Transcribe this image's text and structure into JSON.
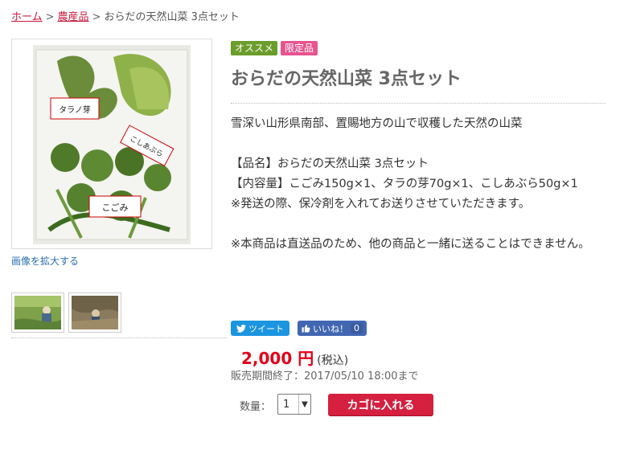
{
  "breadcrumb": {
    "home": "ホーム",
    "separator": ">",
    "category": "農産品",
    "current": "おらだの天然山菜 3点セット"
  },
  "gallery": {
    "zoom_link": "画像を拡大する",
    "main_photo_labels": {
      "label1": "タラノ芽",
      "label2": "こしあぶら",
      "label3": "こごみ"
    }
  },
  "badges": {
    "recommend": "オススメ",
    "limited": "限定品"
  },
  "product": {
    "title": "おらだの天然山菜 3点セット",
    "description": [
      "雪深い山形県南部、置賜地方の山で収穫した天然の山菜",
      "",
      "【品名】おらだの天然山菜 3点セット",
      "【内容量】こごみ150g×1、タラの芽70g×1、こしあぶら50g×1",
      "※発送の際、保冷剤を入れてお送りさせていただきます。",
      "",
      "※本商品は直送品のため、他の商品と一緒に送ることはできません。"
    ]
  },
  "share": {
    "tweet": "ツイート",
    "like": "いいね！",
    "like_count": "0"
  },
  "price": {
    "amount": "2,000 円",
    "tax": "(税込)",
    "sale_end": "販売期間終了：2017/05/10 18:00まで"
  },
  "purchase": {
    "qty_label": "数量：",
    "qty_value": "1",
    "cart_button": "カゴに入れる"
  },
  "colors": {
    "accent_red": "#d5203f",
    "price_red": "#e10019",
    "badge_green": "#6a9d2a",
    "badge_pink": "#e7548f",
    "link_blue": "#2a6fb0"
  },
  "icons": {
    "twitter": "twitter-bird-icon",
    "like": "thumbs-up-icon",
    "dropdown": "chevron-down-icon"
  }
}
